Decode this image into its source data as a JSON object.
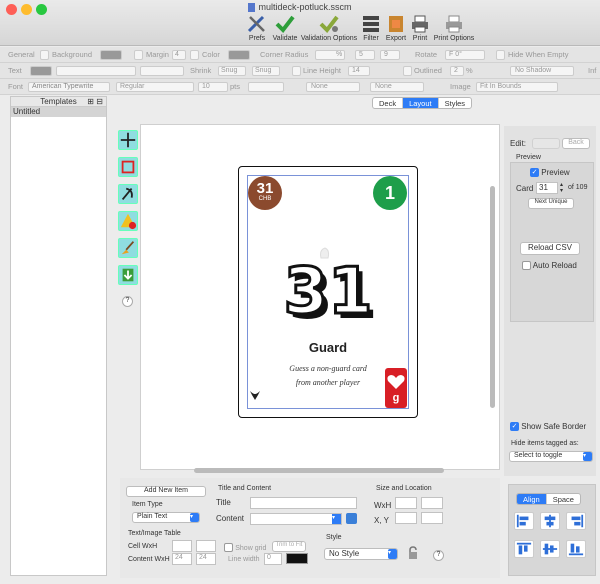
{
  "window": {
    "title": "multideck-potluck.sscm"
  },
  "toolbar": [
    {
      "label": "Prefs",
      "icon": "wrench-screwdriver-icon"
    },
    {
      "label": "Validate",
      "icon": "checkmark-icon"
    },
    {
      "label": "Validation Options",
      "icon": "checkmark-gear-icon"
    },
    {
      "label": "Filter",
      "icon": "filter-icon"
    },
    {
      "label": "Export",
      "icon": "export-icon"
    },
    {
      "label": "Print",
      "icon": "printer-icon"
    },
    {
      "label": "Print Options",
      "icon": "print-options-icon"
    }
  ],
  "prop_rows": {
    "general": {
      "label": "General",
      "background": "Background",
      "margin": "Margin",
      "margin_val": "4",
      "color": "Color",
      "corner_radius": "Corner Radius",
      "pct": "%",
      "cr_a": "5",
      "cr_b": "9",
      "rotate": "Rotate",
      "rotate_val": "F 0°",
      "hide_empty": "Hide When Empty"
    },
    "text": {
      "label": "Text",
      "shrink": "Shrink",
      "snug1": "Snug",
      "snug2": "Snug",
      "line_height": "Line Height",
      "lh_val": "14",
      "outlined": "Outlined",
      "outl_val": "2",
      "pct": "%",
      "shadow": "No Shadow",
      "inf": "Inf"
    },
    "font": {
      "label": "Font",
      "family": "American Typewrite",
      "style": "Regular",
      "size": "10",
      "unit": "pts",
      "none1": "None",
      "none2": "None",
      "image": "Image",
      "fit": "Fit In Bounds"
    }
  },
  "sidebar": {
    "header": "Templates",
    "items": [
      "Untitled"
    ]
  },
  "tabs": [
    {
      "label": "Deck",
      "active": false
    },
    {
      "label": "Layout",
      "active": true
    },
    {
      "label": "Styles",
      "active": false
    }
  ],
  "card": {
    "corner_tl_number": "31",
    "corner_tl_sub": "CHB",
    "corner_tr_number": "1",
    "big_number": "31",
    "title": "Guard",
    "description_line1": "Guess a non-guard card",
    "description_line2": "from another player",
    "corner_br_letter": "g",
    "colors": {
      "tl": "#8b4a2e",
      "tr": "#1e9e4a",
      "br": "#d81f26"
    }
  },
  "right": {
    "edit_label": "Edit:",
    "back_button": "Back",
    "preview_header": "Preview",
    "preview_checkbox": "Preview",
    "card_label": "Card",
    "card_value": "31",
    "card_total": "of 109",
    "next_unique": "Next Unique",
    "reload_csv": "Reload CSV",
    "auto_reload": "Auto Reload",
    "show_safe_border": "Show Safe Border",
    "hide_tagged": "Hide items tagged as:",
    "toggle_select": "Select to toggle",
    "align_tab": "Align",
    "space_tab": "Space"
  },
  "bottom": {
    "add_item": "Add New Item",
    "item_type_label": "Item Type",
    "item_type_value": "Plain Text",
    "text_image_table": "Text/Image Table",
    "cell_wxh": "Cell WxH",
    "content_wxh": "Content WxH",
    "cw_a": "24",
    "cw_b": "24",
    "show_grid": "Show grid",
    "trim": "Trim to Fit",
    "line_width": "Line width",
    "lw_val": "0",
    "title_and_content": "Title and Content",
    "title_label": "Title",
    "content_label": "Content",
    "style_label": "Style",
    "style_value": "No Style",
    "size_location": "Size and Location",
    "wxh": "WxH",
    "xy": "X, Y",
    "help": "?"
  },
  "tools_help": "?"
}
